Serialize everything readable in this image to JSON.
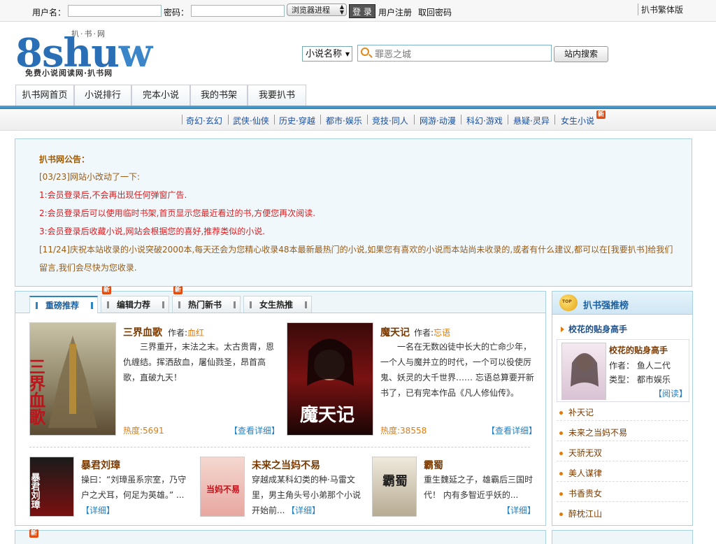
{
  "topbar": {
    "username_label": "用户名：",
    "username_value": "",
    "password_label": "密码：",
    "password_value": "",
    "login_expire_select": "浏览器进程",
    "login_button": "登 录",
    "register_link": "用户注册",
    "recover_link": "取回密码",
    "traditional_link": "扒书繁体版"
  },
  "header": {
    "logo_text_a": "8shu",
    "logo_text_b": "w",
    "logo_subtitle": "扒·书·网",
    "logo_tagline": "免费小说阅读网·扒书网",
    "search_type": "小说名称",
    "search_placeholder": "罪恶之城",
    "search_button": "站内搜索"
  },
  "nav": [
    "扒书网首页",
    "小说排行",
    "完本小说",
    "我的书架",
    "我要扒书"
  ],
  "categories": [
    "奇幻·玄幻",
    "武侠·仙侠",
    "历史·穿越",
    "都市·娱乐",
    "竞技·同人",
    "网游·动漫",
    "科幻·游戏",
    "悬疑·灵异",
    "女生小说"
  ],
  "badge_new": "新",
  "notice": {
    "title": "扒书网公告：",
    "lines": [
      "[03/23]网站小改动了一下:",
      "1:会员登录后,不会再出现任何弹窗广告.",
      "2:会员登录后可以使用临时书架,首页显示您最近看过的书,方便您再次阅读.",
      "3:会员登录后收藏小说,网站会根据您的喜好,推荐类似的小说.",
      "[11/24]庆祝本站收录的小说突破2000本,每天还会为您精心收录48本最新最热门的小说,如果您有喜欢的小说而本站尚未收录的,或者有什么建议,都可以在[我要扒书]给我们",
      "留言,我们会尽快为您收录."
    ]
  },
  "tabs": [
    "重磅推荐",
    "编辑力荐",
    "热门新书",
    "女生热推"
  ],
  "featured": [
    {
      "title": "三界血歌",
      "author_label": "作者:",
      "author": "血红",
      "desc": "　　三界重开，末法之末。太古贵胄，恩仇缠结。挥洒敌血，屠仙戮圣，昂首高歌，直破九天！",
      "heat": "热度:5691",
      "more": "【查看详细】",
      "cover_text": "三界血歌"
    },
    {
      "title": "魔天记",
      "author_label": "作者:",
      "author": "忘语",
      "desc": "　　一名在无数凶徒中长大的亡命少年，一个人与魔并立的时代，一个可以役使厉鬼、妖灵的大千世界…… 忘语总算要开新书了，已有完本作品《凡人修仙传》。",
      "heat": "热度:38558",
      "more": "【查看详细】",
      "cover_text": "魔天记"
    }
  ],
  "small_books": [
    {
      "title": "暴君刘璋",
      "desc": "操曰：“刘璋虽系宗室，乃守户之犬耳，何足为英雄。” ...",
      "more": "【详细】",
      "cover_text": "暴君刘璋"
    },
    {
      "title": "未来之当妈不易",
      "desc": "穿越成某科幻类的种·马雷文里，男主角头号小弟那个小说开始前...",
      "more": "【详细】",
      "cover_text": "当妈不易"
    },
    {
      "title": "霸蜀",
      "desc": "重生魏延之子，雄霸后三国时代！ 内有多智近乎妖的...",
      "more": "【详细】",
      "cover_text": "霸蜀"
    }
  ],
  "sidebar": {
    "title": "扒书强推榜",
    "top_item": "校花的贴身高手",
    "card": {
      "title": "校花的贴身高手",
      "author": "作者： 鱼人二代",
      "type": "类型： 都市娱乐",
      "read": "【阅读】"
    },
    "list": [
      "补天记",
      "未来之当妈不易",
      "天骄无双",
      "美人谋律",
      "书香贵女",
      "醉枕江山"
    ]
  },
  "colors": {
    "accent": "#2c85bf",
    "title_brown": "#7a3a00",
    "orange": "#e07b0a",
    "notice_red": "#e0191b"
  }
}
